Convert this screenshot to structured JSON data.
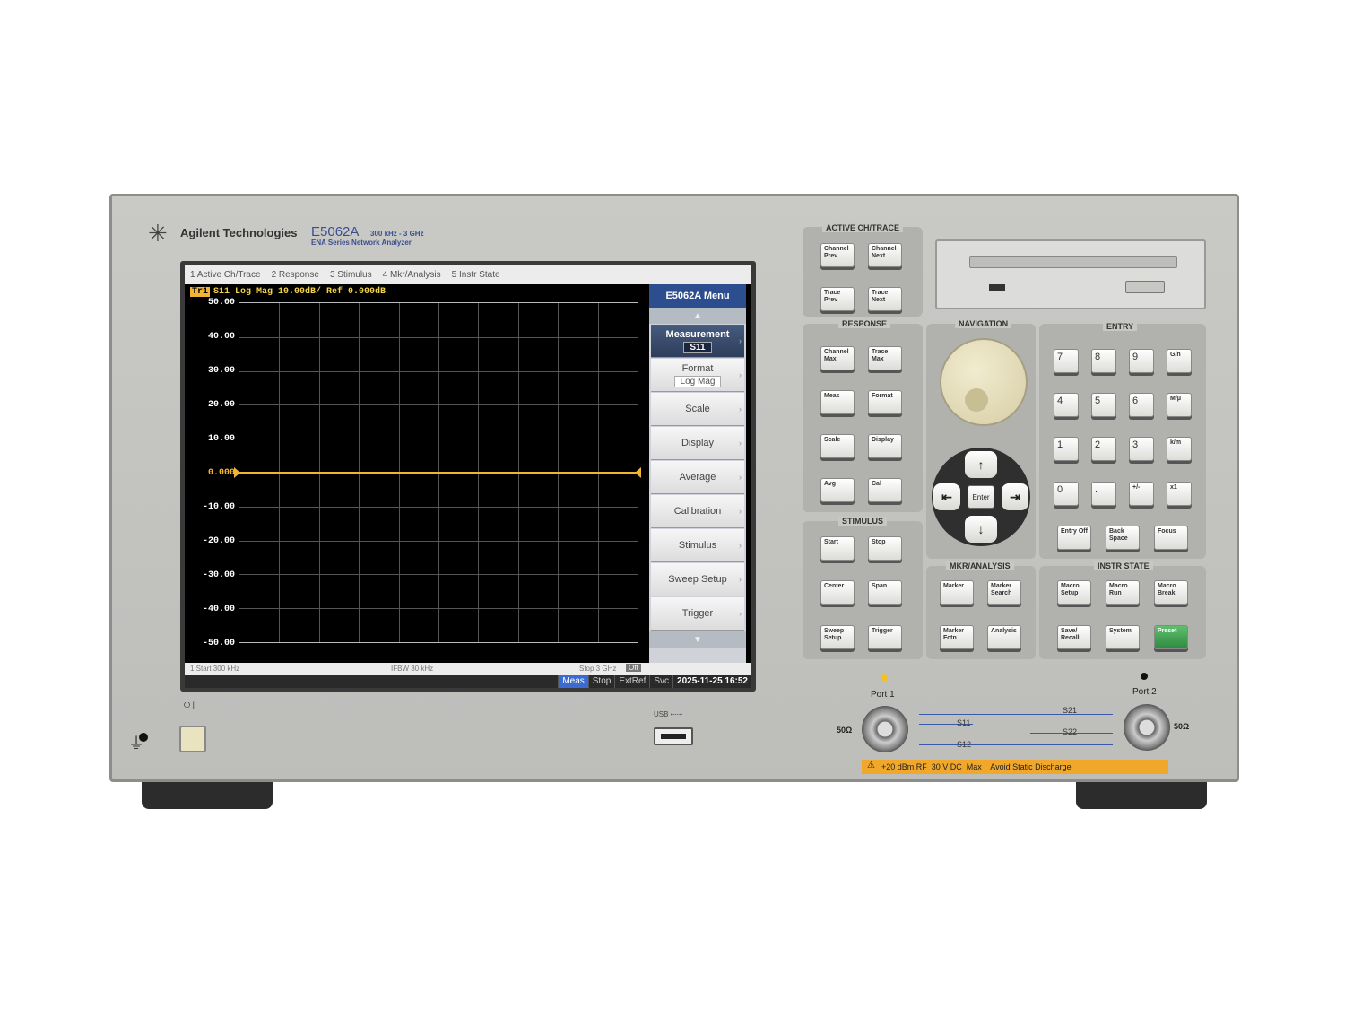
{
  "device": {
    "brand": "Agilent Technologies",
    "model": "E5062A",
    "freq_range": "300 kHz - 3 GHz",
    "series": "ENA Series Network Analyzer"
  },
  "screen": {
    "menu_bar": [
      "1 Active Ch/Trace",
      "2 Response",
      "3 Stimulus",
      "4 Mkr/Analysis",
      "5 Instr State"
    ],
    "trace_badge": "Tr1",
    "trace_header": "S11 Log Mag 10.00dB/ Ref 0.000dB",
    "y_ticks": [
      "50.00",
      "40.00",
      "30.00",
      "20.00",
      "10.00",
      "",
      "-10.00",
      "-20.00",
      "-30.00",
      "-40.00",
      "-50.00"
    ],
    "ref_label": "0.000",
    "softkey_title": "E5062A Menu",
    "softkeys": [
      {
        "label": "Measurement",
        "value": "S11"
      },
      {
        "label": "Format",
        "value": "Log Mag"
      },
      {
        "label": "Scale",
        "value": ""
      },
      {
        "label": "Display",
        "value": ""
      },
      {
        "label": "Average",
        "value": ""
      },
      {
        "label": "Calibration",
        "value": ""
      },
      {
        "label": "Stimulus",
        "value": ""
      },
      {
        "label": "Sweep Setup",
        "value": ""
      },
      {
        "label": "Trigger",
        "value": ""
      }
    ],
    "status": {
      "start": "1  Start 300 kHz",
      "ifbw": "IFBW 30 kHz",
      "stop": "Stop 3 GHz",
      "off": "Off",
      "meas": "Meas",
      "stop_state": "Stop",
      "extref": "ExtRef",
      "svc": "Svc",
      "datetime": "2025-11-25 16:52"
    }
  },
  "chart_data": {
    "type": "line",
    "title": "S11 Log Mag 10.00dB/ Ref 0.000dB",
    "xlabel": "",
    "ylabel": "",
    "ylim": [
      -50,
      50
    ],
    "x": [
      "Start 300 kHz",
      "Stop 3 GHz"
    ],
    "series": [
      {
        "name": "S11",
        "values": [
          0,
          0
        ]
      }
    ],
    "grid": true
  },
  "panel": {
    "groups": {
      "active": "ACTIVE CH/TRACE",
      "response": "RESPONSE",
      "stimulus": "STIMULUS",
      "navigation": "NAVIGATION",
      "entry": "ENTRY",
      "mkr": "MKR/ANALYSIS",
      "instr": "INSTR STATE"
    },
    "keys": {
      "channel_prev": "Channel Prev",
      "channel_next": "Channel Next",
      "trace_prev": "Trace Prev",
      "trace_next": "Trace Next",
      "channel_max": "Channel Max",
      "trace_max": "Trace Max",
      "meas": "Meas",
      "format": "Format",
      "scale": "Scale",
      "display": "Display",
      "avg": "Avg",
      "cal": "Cal",
      "start": "Start",
      "stop": "Stop",
      "center": "Center",
      "span": "Span",
      "sweep_setup": "Sweep Setup",
      "trigger": "Trigger",
      "marker": "Marker",
      "marker_search": "Marker Search",
      "marker_fctn": "Marker Fctn",
      "analysis": "Analysis",
      "macro_setup": "Macro Setup",
      "macro_run": "Macro Run",
      "macro_break": "Macro Break",
      "save_recall": "Save/ Recall",
      "system": "System",
      "preset": "Preset",
      "entry_off": "Entry Off",
      "back_space": "Back Space",
      "focus": "Focus",
      "enter": "Enter"
    },
    "numpad": [
      "7",
      "8",
      "9",
      "G/n",
      "4",
      "5",
      "6",
      "M/μ",
      "1",
      "2",
      "3",
      "k/m",
      "0",
      ".",
      "+/-",
      "x1"
    ]
  },
  "front": {
    "power_label": "⏻ |",
    "usb_label": "USB ⇠⇢",
    "port1": "Port 1",
    "port2": "Port 2",
    "ohm": "50Ω",
    "s11": "S11",
    "s12": "S12",
    "s21": "S21",
    "s22": "S22",
    "warning": "+20 dBm RF  30 V DC  Max    Avoid Static Discharge"
  }
}
